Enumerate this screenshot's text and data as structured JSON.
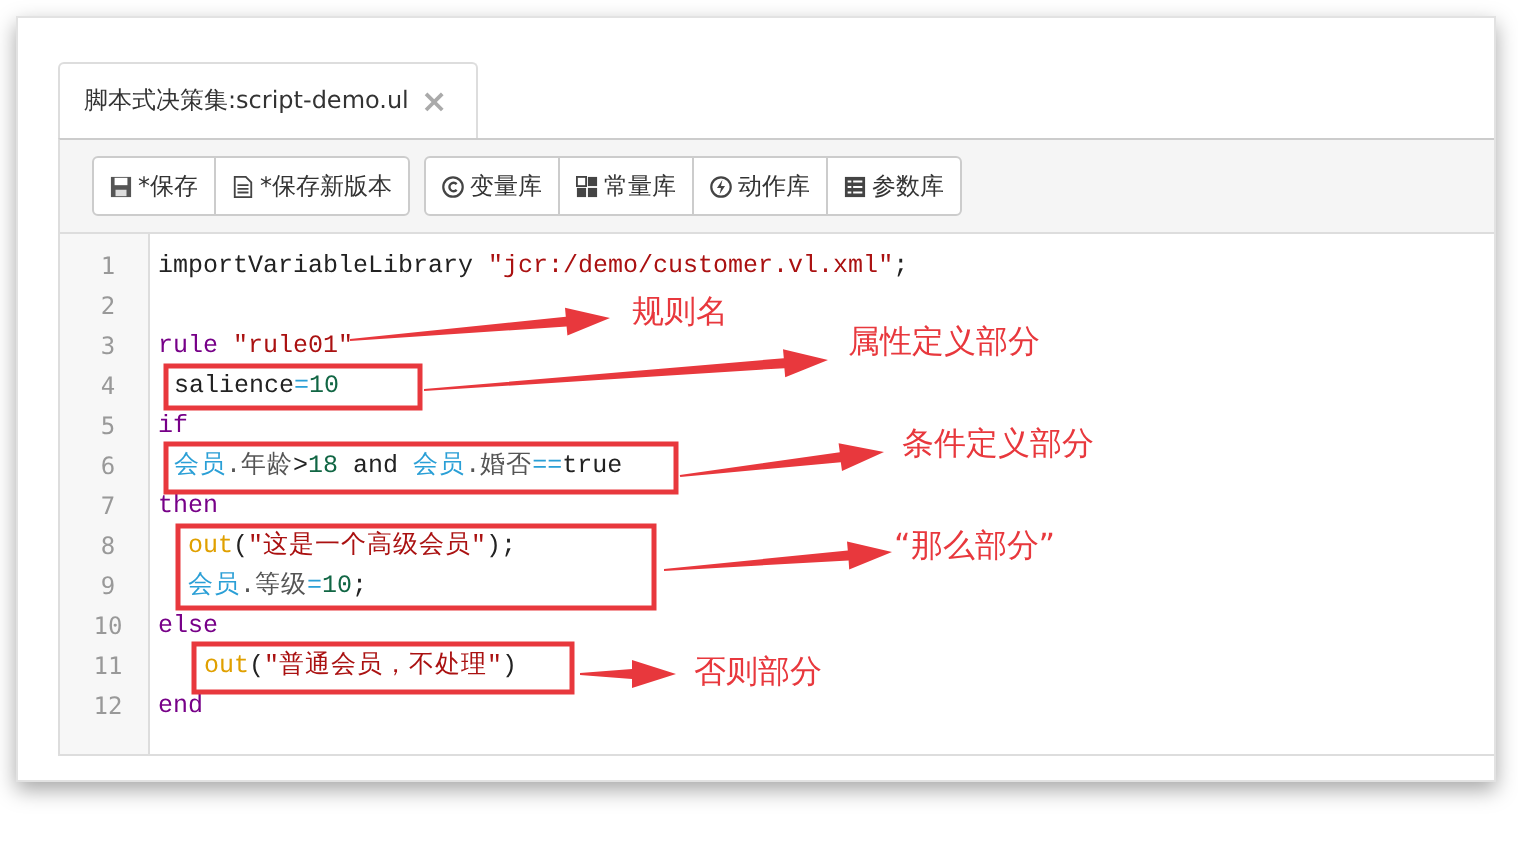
{
  "tab": {
    "label": "脚本式决策集:script-demo.ul",
    "close": "×",
    "selected": true
  },
  "toolbar": [
    [
      {
        "kind": "save",
        "label": "*保存"
      },
      {
        "kind": "file",
        "label": "*保存新版本"
      }
    ],
    [
      {
        "kind": "copyright",
        "label": "变量库"
      },
      {
        "kind": "blocks",
        "label": "常量库"
      },
      {
        "kind": "bolt",
        "label": "动作库"
      },
      {
        "kind": "list",
        "label": "参数库"
      }
    ]
  ],
  "code": [
    {
      "number": "1",
      "kind": "top",
      "tokens": [
        {
          "kind": "plain",
          "text": "importVariableLibrary "
        },
        {
          "kind": "string",
          "text": "\"jcr:/demo/customer.vl.xml\""
        },
        {
          "kind": "plain",
          "text": ";"
        }
      ]
    },
    {
      "number": "2",
      "kind": "top"
    },
    {
      "number": "3",
      "kind": "top",
      "tokens": [
        {
          "kind": "keyword",
          "text": "rule "
        },
        {
          "kind": "string",
          "text": "\"rule01\""
        }
      ]
    },
    {
      "number": "4",
      "kind": "attr",
      "tokens": [
        {
          "kind": "plain",
          "text": "salience"
        },
        {
          "kind": "op",
          "text": "="
        },
        {
          "kind": "number",
          "text": "10"
        }
      ]
    },
    {
      "number": "5",
      "kind": "top",
      "tokens": [
        {
          "kind": "keyword",
          "text": "if"
        }
      ]
    },
    {
      "number": "6",
      "kind": "attr",
      "tokens": [
        {
          "kind": "var",
          "text": "会员"
        },
        {
          "kind": "prop",
          "text": ".年龄"
        },
        {
          "kind": "plain",
          "text": ">"
        },
        {
          "kind": "number",
          "text": "18"
        },
        {
          "kind": "plain",
          "text": " and "
        },
        {
          "kind": "var",
          "text": "会员"
        },
        {
          "kind": "prop",
          "text": ".婚否"
        },
        {
          "kind": "op",
          "text": "=="
        },
        {
          "kind": "plain",
          "text": "true"
        }
      ]
    },
    {
      "number": "7",
      "kind": "top",
      "tokens": [
        {
          "kind": "keyword",
          "text": "then"
        }
      ]
    },
    {
      "number": "8",
      "kind": "body",
      "tokens": [
        {
          "kind": "func",
          "text": "out"
        },
        {
          "kind": "plain",
          "text": "("
        },
        {
          "kind": "string",
          "text": "\"这是一个高级会员\""
        },
        {
          "kind": "plain",
          "text": ");"
        }
      ]
    },
    {
      "number": "9",
      "kind": "body",
      "tokens": [
        {
          "kind": "var",
          "text": "会员"
        },
        {
          "kind": "prop",
          "text": ".等级"
        },
        {
          "kind": "op",
          "text": "="
        },
        {
          "kind": "number",
          "text": "10"
        },
        {
          "kind": "plain",
          "text": ";"
        }
      ]
    },
    {
      "number": "10",
      "kind": "top",
      "tokens": [
        {
          "kind": "keyword",
          "text": "else"
        }
      ]
    },
    {
      "number": "11",
      "kind": "deep",
      "tokens": [
        {
          "kind": "func",
          "text": "out"
        },
        {
          "kind": "plain",
          "text": "("
        },
        {
          "kind": "string",
          "text": "\"普通会员，不处理\""
        },
        {
          "kind": "plain",
          "text": ")"
        }
      ]
    },
    {
      "number": "12",
      "kind": "top",
      "tokens": [
        {
          "kind": "keyword",
          "text": "end"
        }
      ]
    }
  ],
  "annotations": [
    {
      "label": "规则名"
    },
    {
      "label": "属性定义部分"
    },
    {
      "label": "条件定义部分"
    },
    {
      "label": "“那么部分”"
    },
    {
      "label": "否则部分"
    }
  ]
}
